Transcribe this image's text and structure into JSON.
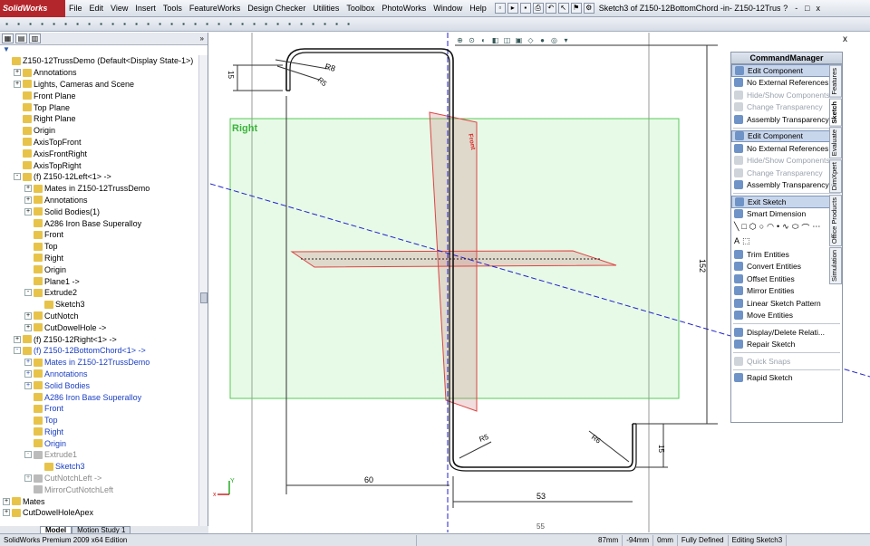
{
  "app": {
    "logo": "SolidWorks",
    "menus": [
      "File",
      "Edit",
      "View",
      "Insert",
      "Tools",
      "FeatureWorks",
      "Design Checker",
      "Utilities",
      "Toolbox",
      "PhotoWorks",
      "Window",
      "Help"
    ],
    "window_title": "Sketch3 of Z150-12BottomChord -in- Z150-12Truss...",
    "win_help": "?",
    "win_min": "-",
    "win_max": "□",
    "win_close": "x"
  },
  "feature_tree": {
    "filter_icon": "funnel-icon",
    "nodes": [
      {
        "text": "Z150-12TrussDemo  (Default<Display State-1>)",
        "indent": 0,
        "exp": "",
        "cls": ""
      },
      {
        "text": "Annotations",
        "indent": 1,
        "exp": "+",
        "cls": ""
      },
      {
        "text": "Lights, Cameras and Scene",
        "indent": 1,
        "exp": "+",
        "cls": ""
      },
      {
        "text": "Front Plane",
        "indent": 1,
        "exp": "",
        "cls": ""
      },
      {
        "text": "Top Plane",
        "indent": 1,
        "exp": "",
        "cls": ""
      },
      {
        "text": "Right Plane",
        "indent": 1,
        "exp": "",
        "cls": ""
      },
      {
        "text": "Origin",
        "indent": 1,
        "exp": "",
        "cls": ""
      },
      {
        "text": "AxisTopFront",
        "indent": 1,
        "exp": "",
        "cls": ""
      },
      {
        "text": "AxisFrontRight",
        "indent": 1,
        "exp": "",
        "cls": ""
      },
      {
        "text": "AxisTopRight",
        "indent": 1,
        "exp": "",
        "cls": ""
      },
      {
        "text": "(f) Z150-12Left<1> ->",
        "indent": 1,
        "exp": "-",
        "cls": ""
      },
      {
        "text": "Mates in Z150-12TrussDemo",
        "indent": 2,
        "exp": "+",
        "cls": ""
      },
      {
        "text": "Annotations",
        "indent": 2,
        "exp": "+",
        "cls": ""
      },
      {
        "text": "Solid Bodies(1)",
        "indent": 2,
        "exp": "+",
        "cls": ""
      },
      {
        "text": "A286 Iron Base Superalloy",
        "indent": 2,
        "exp": "",
        "cls": ""
      },
      {
        "text": "Front",
        "indent": 2,
        "exp": "",
        "cls": ""
      },
      {
        "text": "Top",
        "indent": 2,
        "exp": "",
        "cls": ""
      },
      {
        "text": "Right",
        "indent": 2,
        "exp": "",
        "cls": ""
      },
      {
        "text": "Origin",
        "indent": 2,
        "exp": "",
        "cls": ""
      },
      {
        "text": "Plane1 ->",
        "indent": 2,
        "exp": "",
        "cls": ""
      },
      {
        "text": "Extrude2",
        "indent": 2,
        "exp": "-",
        "cls": ""
      },
      {
        "text": "Sketch3",
        "indent": 3,
        "exp": "",
        "cls": ""
      },
      {
        "text": "CutNotch",
        "indent": 2,
        "exp": "+",
        "cls": ""
      },
      {
        "text": "CutDowelHole ->",
        "indent": 2,
        "exp": "+",
        "cls": ""
      },
      {
        "text": "(f) Z150-12Right<1> ->",
        "indent": 1,
        "exp": "+",
        "cls": ""
      },
      {
        "text": "(f) Z150-12BottomChord<1> ->",
        "indent": 1,
        "exp": "-",
        "cls": "blue"
      },
      {
        "text": "Mates in Z150-12TrussDemo",
        "indent": 2,
        "exp": "+",
        "cls": "blue"
      },
      {
        "text": "Annotations",
        "indent": 2,
        "exp": "+",
        "cls": "blue"
      },
      {
        "text": "Solid Bodies",
        "indent": 2,
        "exp": "+",
        "cls": "blue"
      },
      {
        "text": "A286 Iron Base Superalloy",
        "indent": 2,
        "exp": "",
        "cls": "blue"
      },
      {
        "text": "Front",
        "indent": 2,
        "exp": "",
        "cls": "blue"
      },
      {
        "text": "Top",
        "indent": 2,
        "exp": "",
        "cls": "blue"
      },
      {
        "text": "Right",
        "indent": 2,
        "exp": "",
        "cls": "blue"
      },
      {
        "text": "Origin",
        "indent": 2,
        "exp": "",
        "cls": "blue"
      },
      {
        "text": "Extrude1",
        "indent": 2,
        "exp": "-",
        "cls": "grey"
      },
      {
        "text": "Sketch3",
        "indent": 3,
        "exp": "",
        "cls": "blue"
      },
      {
        "text": "CutNotchLeft ->",
        "indent": 2,
        "exp": "+",
        "cls": "grey"
      },
      {
        "text": "MirrorCutNotchLeft",
        "indent": 2,
        "exp": "",
        "cls": "grey"
      },
      {
        "text": "Mates",
        "indent": 0,
        "exp": "+",
        "cls": ""
      },
      {
        "text": "CutDowelHoleApex",
        "indent": 0,
        "exp": "+",
        "cls": ""
      }
    ]
  },
  "bottom_tabs": [
    "Model",
    "Motion Study 1"
  ],
  "status": {
    "edition": "SolidWorks Premium 2009 x64 Edition",
    "x": "87mm",
    "y": "-94mm",
    "z": "0mm",
    "state": "Fully Defined",
    "editing": "Editing Sketch3"
  },
  "viewport": {
    "plane_label": "Right",
    "front_label": "Front",
    "dims": {
      "d15_top": "15",
      "r8": "R8",
      "r5_top": "R5",
      "d152": "152",
      "d60": "60",
      "r5_bot": "R5",
      "r6": "R6",
      "d15_bot": "15",
      "d53": "53",
      "d55": "55"
    },
    "triad": {
      "x": "x",
      "y": "Y"
    }
  },
  "command_manager": {
    "title": "CommandManager",
    "items": [
      {
        "label": "Edit Component",
        "state": "sel"
      },
      {
        "label": "No External References",
        "state": ""
      },
      {
        "label": "Hide/Show Components",
        "state": "dis"
      },
      {
        "label": "Change Transparency",
        "state": "dis"
      },
      {
        "label": "Assembly Transparency",
        "state": ""
      },
      {
        "sep": true
      },
      {
        "label": "Edit Component",
        "state": "sel"
      },
      {
        "label": "No External References",
        "state": ""
      },
      {
        "label": "Hide/Show Components",
        "state": "dis"
      },
      {
        "label": "Change Transparency",
        "state": "dis"
      },
      {
        "label": "Assembly Transparency",
        "state": ""
      },
      {
        "sep": true
      },
      {
        "label": "Exit Sketch",
        "state": "sel"
      },
      {
        "label": "Smart Dimension",
        "state": ""
      }
    ],
    "items2": [
      {
        "label": "Trim Entities",
        "state": ""
      },
      {
        "label": "Convert Entities",
        "state": ""
      },
      {
        "label": "Offset Entities",
        "state": ""
      },
      {
        "label": "Mirror Entities",
        "state": ""
      },
      {
        "label": "Linear Sketch Pattern",
        "state": ""
      },
      {
        "label": "Move Entities",
        "state": ""
      },
      {
        "sep": true
      },
      {
        "label": "Display/Delete Relati...",
        "state": ""
      },
      {
        "label": "Repair Sketch",
        "state": ""
      },
      {
        "sep": true
      },
      {
        "label": "Quick Snaps",
        "state": "dis"
      },
      {
        "sep": true
      },
      {
        "label": "Rapid Sketch",
        "state": ""
      }
    ],
    "side_tabs": [
      "Features",
      "Sketch",
      "Evaluate",
      "DimXpert",
      "Office Products",
      "Simulation"
    ],
    "close": "x"
  }
}
